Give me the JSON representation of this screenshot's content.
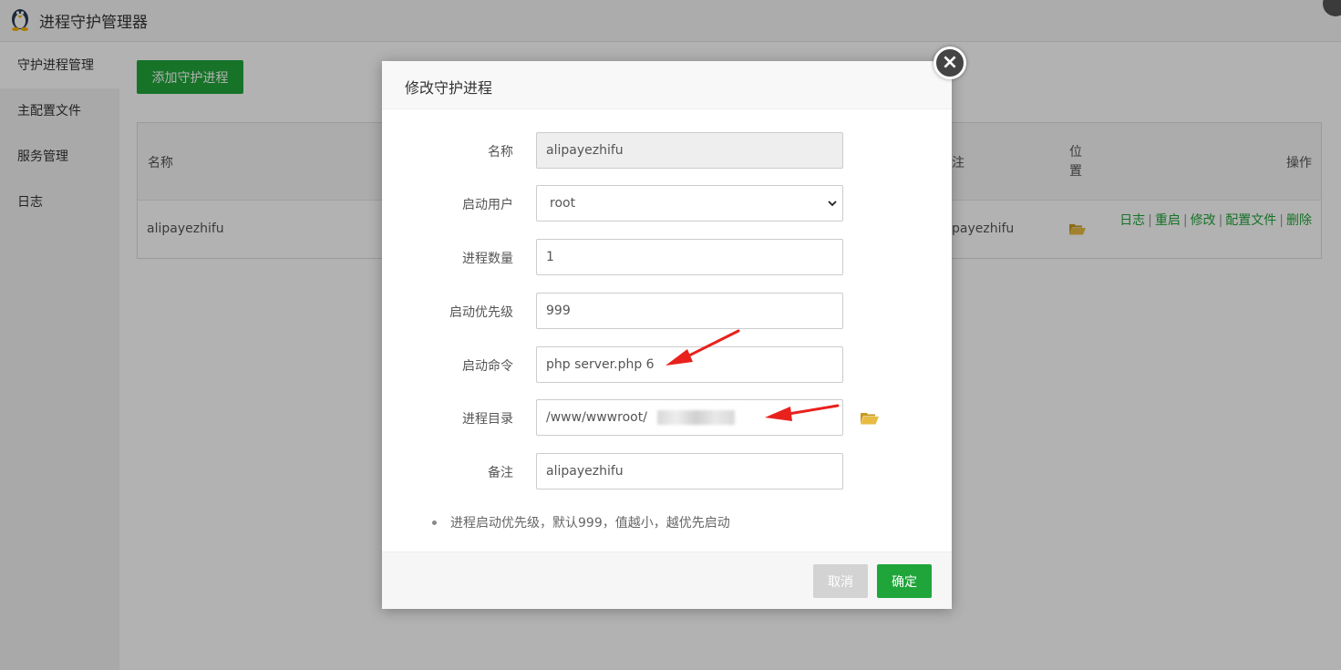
{
  "app": {
    "title": "进程守护管理器",
    "icon": "penguin-icon"
  },
  "sidebar": {
    "items": [
      {
        "label": "守护进程管理",
        "active": true
      },
      {
        "label": "主配置文件"
      },
      {
        "label": "服务管理"
      },
      {
        "label": "日志"
      }
    ]
  },
  "main": {
    "add_button": "添加守护进程",
    "table": {
      "headers": {
        "name": "名称",
        "note": "注",
        "location": "位置",
        "actions": "操作"
      },
      "row": {
        "name": "alipayezhifu",
        "note": "payezhifu",
        "actions": [
          "日志",
          "重启",
          "修改",
          "配置文件",
          "删除"
        ]
      }
    }
  },
  "modal": {
    "title": "修改守护进程",
    "close_label": "×",
    "fields": {
      "name": {
        "label": "名称",
        "value": "alipayezhifu"
      },
      "user": {
        "label": "启动用户",
        "value": "root"
      },
      "count": {
        "label": "进程数量",
        "value": "1"
      },
      "priority": {
        "label": "启动优先级",
        "value": "999"
      },
      "command": {
        "label": "启动命令",
        "value": "php server.php 6"
      },
      "directory": {
        "label": "进程目录",
        "value": "/www/wwwroot/             c/"
      },
      "note": {
        "label": "备注",
        "value": "alipayezhifu"
      }
    },
    "tip": "进程启动优先级，默认999，值越小，越优先启动",
    "cancel": "取消",
    "confirm": "确定"
  },
  "colors": {
    "accent": "#20a53a",
    "annotation": "#e8211c",
    "folder": "#e5b53a"
  }
}
